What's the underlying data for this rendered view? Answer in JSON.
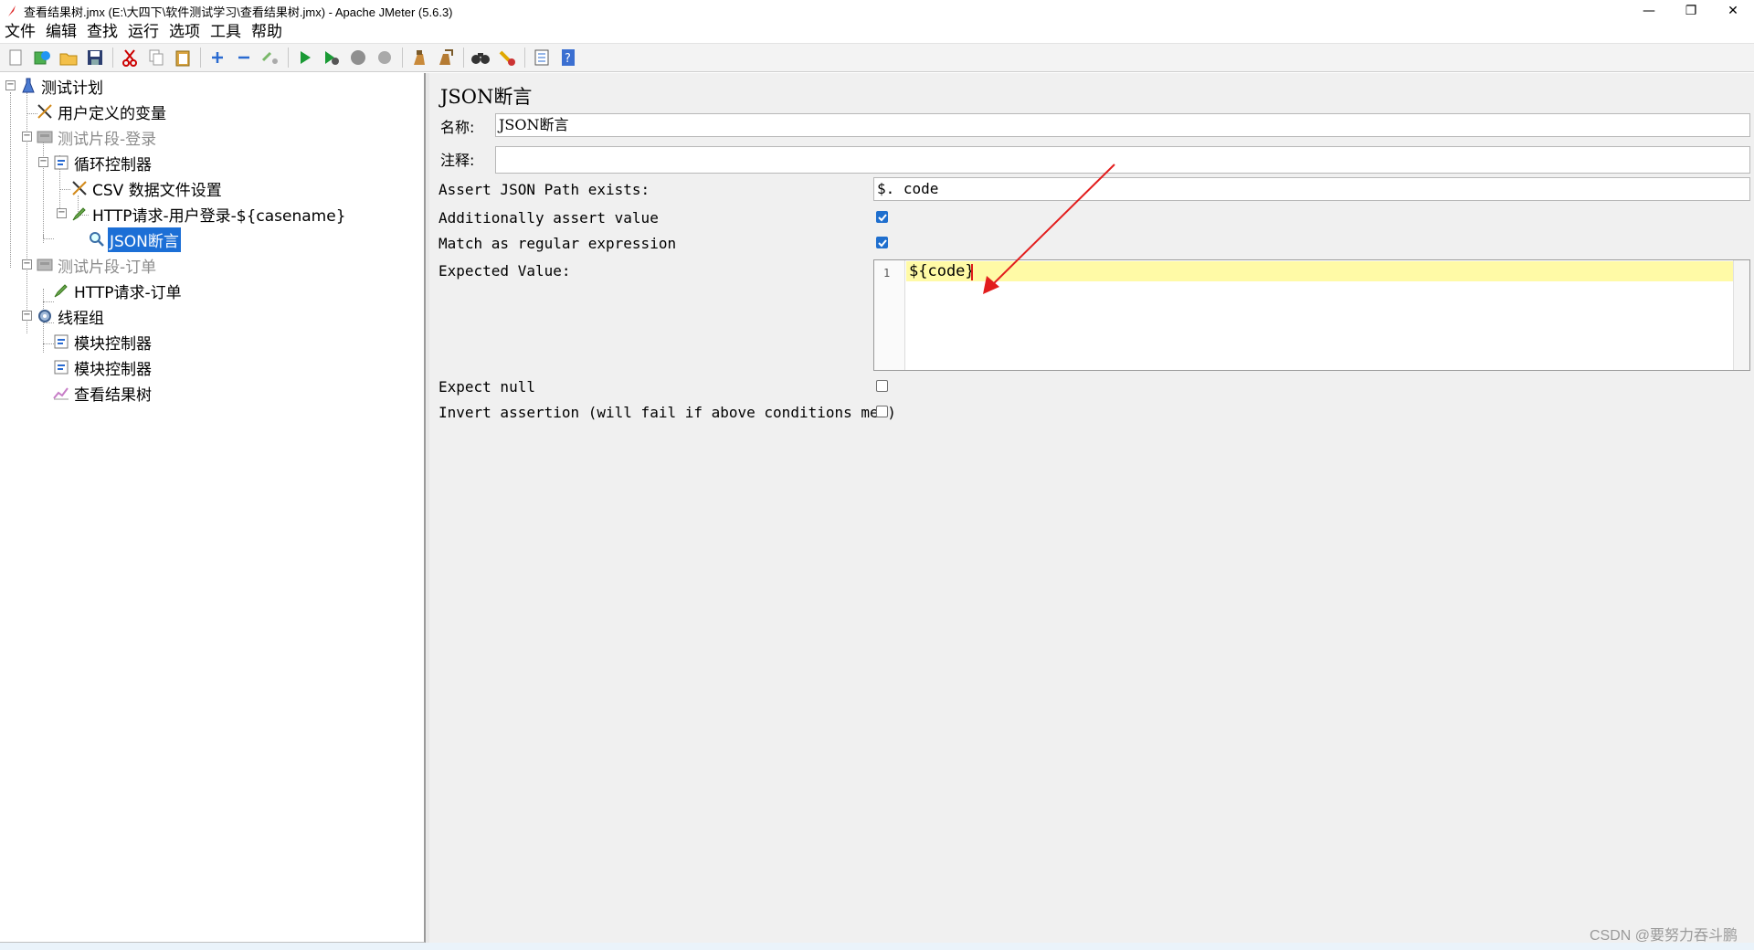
{
  "window": {
    "title": "查看结果树.jmx (E:\\大四下\\软件测试学习\\查看结果树.jmx) - Apache JMeter (5.6.3)",
    "minimize": "—",
    "restore": "❐",
    "close": "✕"
  },
  "menu": [
    "文件",
    "编辑",
    "查找",
    "运行",
    "选项",
    "工具",
    "帮助"
  ],
  "toolbar": {
    "icons": [
      "new-icon",
      "templates-icon",
      "open-icon",
      "save-icon",
      "cut-icon",
      "copy-icon",
      "paste-icon",
      "expand-icon",
      "collapse-icon",
      "toggle-icon",
      "start-icon",
      "start-no-pauses-icon",
      "stop-icon",
      "shutdown-icon",
      "clear-icon",
      "clear-all-icon",
      "search-icon",
      "reset-search-icon",
      "function-helper-icon",
      "help-icon"
    ]
  },
  "tree": {
    "nodes": [
      {
        "label": "测试计划",
        "icon": "test-plan-icon",
        "dim": false
      },
      {
        "label": "用户定义的变量",
        "icon": "config-tools-icon",
        "dim": false
      },
      {
        "label": "测试片段-登录",
        "icon": "fragment-icon",
        "dim": true
      },
      {
        "label": "循环控制器",
        "icon": "controller-icon",
        "dim": false
      },
      {
        "label": "CSV 数据文件设置",
        "icon": "config-tools-icon",
        "dim": false
      },
      {
        "label": "HTTP请求-用户登录-${casename}",
        "icon": "sampler-pen-icon",
        "dim": false
      },
      {
        "label": "JSON断言",
        "icon": "assertion-magnifier-icon",
        "dim": false,
        "selected": true
      },
      {
        "label": "测试片段-订单",
        "icon": "fragment-icon",
        "dim": true
      },
      {
        "label": "HTTP请求-订单",
        "icon": "sampler-pen-icon",
        "dim": false
      },
      {
        "label": "线程组",
        "icon": "thread-group-gear-icon",
        "dim": false
      },
      {
        "label": "模块控制器",
        "icon": "controller-icon",
        "dim": false
      },
      {
        "label": "模块控制器",
        "icon": "controller-icon",
        "dim": false
      },
      {
        "label": "查看结果树",
        "icon": "listener-chart-icon",
        "dim": false
      }
    ]
  },
  "panel": {
    "title": "JSON断言",
    "name_label": "名称:",
    "name_value": "JSON断言",
    "comment_label": "注释:",
    "comment_value": "",
    "path_label": "Assert JSON Path exists:",
    "path_value": "$. code",
    "additionally_label": "Additionally assert value",
    "additionally_checked": true,
    "regex_label": "Match as regular expression",
    "regex_checked": true,
    "expected_label": "Expected Value:",
    "expected_line_no": "1",
    "expected_value": "${code}",
    "expect_null_label": "Expect null",
    "expect_null_checked": false,
    "invert_label": "Invert assertion (will fail if above conditions met)",
    "invert_checked": false
  },
  "colors": {
    "selection": "#1c6fd6",
    "checkbox_checked": "#1f6fce",
    "current_line": "#fffaa6",
    "annotation_arrow": "#e21d1d"
  },
  "watermark": "CSDN @要努力吞斗鹏"
}
